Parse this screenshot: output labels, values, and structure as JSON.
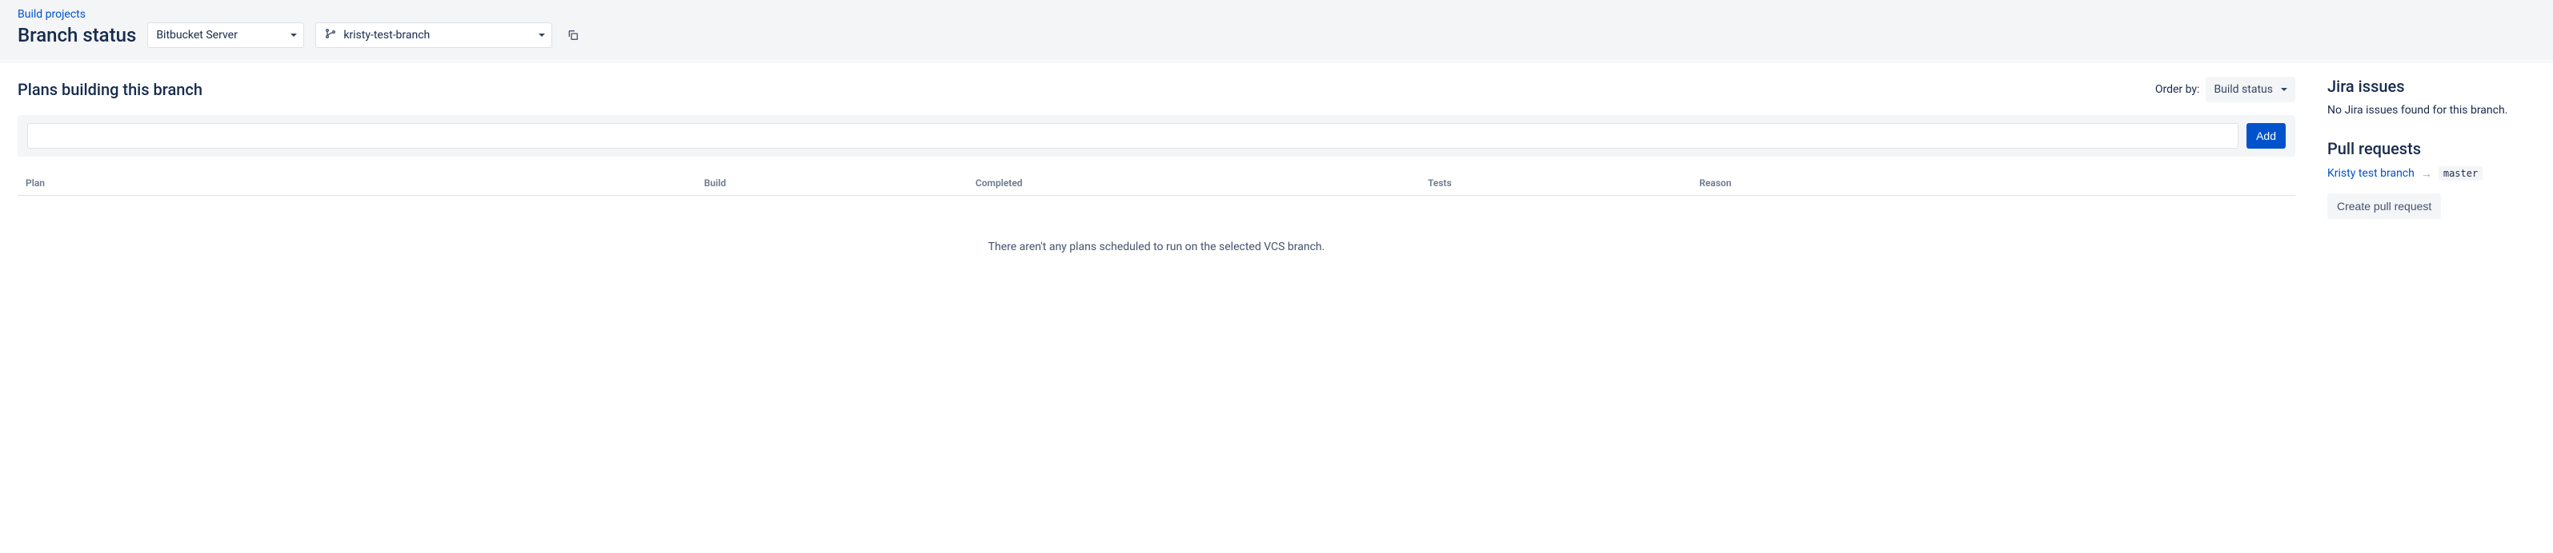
{
  "header": {
    "breadcrumb": "Build projects",
    "title": "Branch status",
    "repo_selector": "Bitbucket Server",
    "branch_selector": "kristy-test-branch"
  },
  "main": {
    "heading": "Plans building this branch",
    "order_by_label": "Order by:",
    "order_by_value": "Build status",
    "add_button": "Add",
    "columns": {
      "plan": "Plan",
      "build": "Build",
      "completed": "Completed",
      "tests": "Tests",
      "reason": "Reason"
    },
    "empty_message": "There aren't any plans scheduled to run on the selected VCS branch."
  },
  "sidebar": {
    "jira_heading": "Jira issues",
    "jira_empty": "No Jira issues found for this branch.",
    "pr_heading": "Pull requests",
    "pr_source": "Kristy test branch",
    "pr_target": "master",
    "create_pr_button": "Create pull request"
  }
}
